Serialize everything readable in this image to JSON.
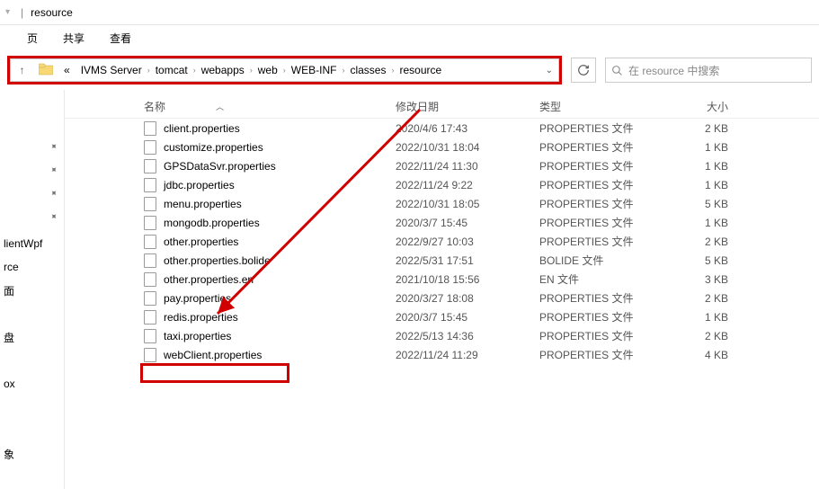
{
  "title": {
    "sep": "|",
    "text": "resource"
  },
  "menu": {
    "back_fragment": "页",
    "share": "共享",
    "view": "查看"
  },
  "address": {
    "dbl_chevron": "«",
    "crumbs": [
      "IVMS Server",
      "tomcat",
      "webapps",
      "web",
      "WEB-INF",
      "classes",
      "resource"
    ]
  },
  "search": {
    "placeholder": "在 resource 中搜索"
  },
  "columns": {
    "name": "名称",
    "date": "修改日期",
    "type": "类型",
    "size": "大小"
  },
  "sidebar": {
    "items": [
      {
        "label": ""
      },
      {
        "label": ""
      },
      {
        "label": ""
      },
      {
        "label": ""
      },
      {
        "label": "lientWpf"
      },
      {
        "label": "rce"
      },
      {
        "label": "面"
      },
      {
        "label": ""
      },
      {
        "label": "盘"
      },
      {
        "label": ""
      },
      {
        "label": "ox"
      },
      {
        "label": ""
      },
      {
        "label": ""
      },
      {
        "label": "象"
      }
    ]
  },
  "files": [
    {
      "name": "client.properties",
      "date": "2020/4/6 17:43",
      "type": "PROPERTIES 文件",
      "size": "2 KB"
    },
    {
      "name": "customize.properties",
      "date": "2022/10/31 18:04",
      "type": "PROPERTIES 文件",
      "size": "1 KB"
    },
    {
      "name": "GPSDataSvr.properties",
      "date": "2022/11/24 11:30",
      "type": "PROPERTIES 文件",
      "size": "1 KB"
    },
    {
      "name": "jdbc.properties",
      "date": "2022/11/24 9:22",
      "type": "PROPERTIES 文件",
      "size": "1 KB"
    },
    {
      "name": "menu.properties",
      "date": "2022/10/31 18:05",
      "type": "PROPERTIES 文件",
      "size": "5 KB"
    },
    {
      "name": "mongodb.properties",
      "date": "2020/3/7 15:45",
      "type": "PROPERTIES 文件",
      "size": "1 KB"
    },
    {
      "name": "other.properties",
      "date": "2022/9/27 10:03",
      "type": "PROPERTIES 文件",
      "size": "2 KB"
    },
    {
      "name": "other.properties.bolide",
      "date": "2022/5/31 17:51",
      "type": "BOLIDE 文件",
      "size": "5 KB"
    },
    {
      "name": "other.properties.en",
      "date": "2021/10/18 15:56",
      "type": "EN 文件",
      "size": "3 KB"
    },
    {
      "name": "pay.properties",
      "date": "2020/3/27 18:08",
      "type": "PROPERTIES 文件",
      "size": "2 KB"
    },
    {
      "name": "redis.properties",
      "date": "2020/3/7 15:45",
      "type": "PROPERTIES 文件",
      "size": "1 KB"
    },
    {
      "name": "taxi.properties",
      "date": "2022/5/13 14:36",
      "type": "PROPERTIES 文件",
      "size": "2 KB"
    },
    {
      "name": "webClient.properties",
      "date": "2022/11/24 11:29",
      "type": "PROPERTIES 文件",
      "size": "4 KB"
    }
  ]
}
